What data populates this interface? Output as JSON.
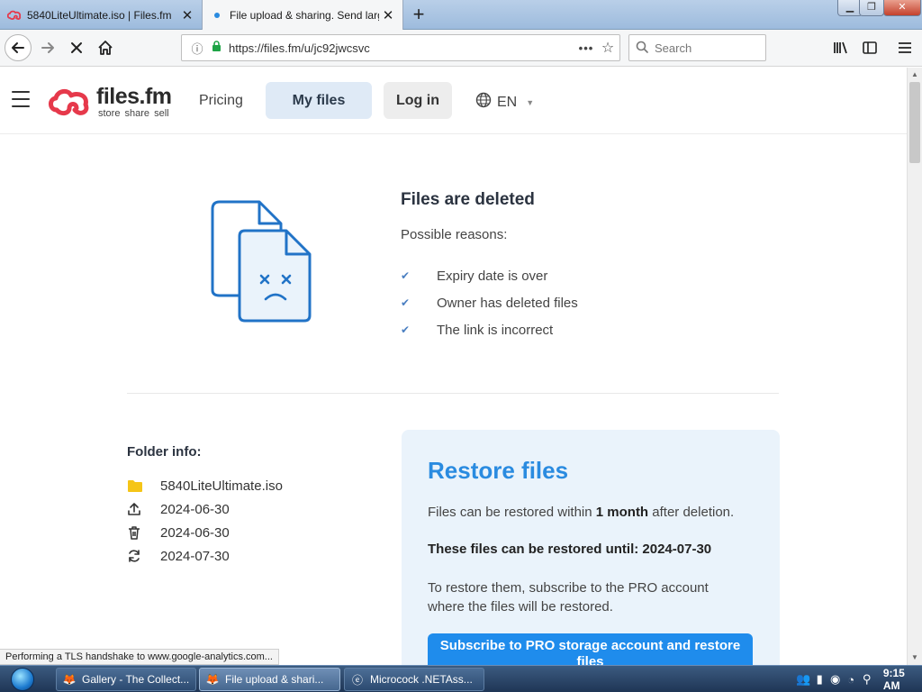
{
  "browser": {
    "tabs": [
      {
        "title": "5840LiteUltimate.iso | Files.fm",
        "active": false
      },
      {
        "title": "File upload & sharing. Send large files",
        "active": true
      }
    ],
    "new_tab_symbol": "+",
    "address": {
      "url": "https://files.fm/u/jc92jwcsvc"
    },
    "search": {
      "placeholder": "Search"
    }
  },
  "site": {
    "logo": {
      "name": "files.fm",
      "tagline": "store share sell"
    },
    "nav": {
      "pricing": "Pricing",
      "my_files": "My files",
      "login": "Log in",
      "language": "EN"
    }
  },
  "deleted": {
    "title": "Files are deleted",
    "reasons_label": "Possible reasons:",
    "reasons": [
      "Expiry date is over",
      "Owner has deleted files",
      "The link is incorrect"
    ]
  },
  "folder_info": {
    "title": "Folder info:",
    "rows": [
      {
        "icon": "folder-icon",
        "value": "5840LiteUltimate.iso"
      },
      {
        "icon": "upload-icon",
        "value": "2024-06-30"
      },
      {
        "icon": "trash-icon",
        "value": "2024-06-30"
      },
      {
        "icon": "refresh-icon",
        "value": "2024-07-30"
      }
    ]
  },
  "restore": {
    "title": "Restore files",
    "p1_pre": "Files can be restored within ",
    "p1_bold": "1 month",
    "p1_post": " after deletion.",
    "p2": "These files can be restored until: 2024-07-30",
    "p3": "To restore them, subscribe to the PRO account where the files will be restored.",
    "button": "Subscribe to PRO storage account and restore files"
  },
  "status_text": "Performing a TLS handshake to www.google-analytics.com...",
  "taskbar": {
    "tasks": [
      {
        "label": "Gallery - The Collect...",
        "active": false
      },
      {
        "label": "File upload & shari...",
        "active": true
      },
      {
        "label": "Microcock .NETAss...",
        "active": false
      }
    ],
    "clock": "9:15 AM"
  },
  "colors": {
    "accent": "#2a8be0",
    "button": "#1f8cec",
    "logo_red": "#e6394b",
    "illustration": "#2173c7"
  }
}
